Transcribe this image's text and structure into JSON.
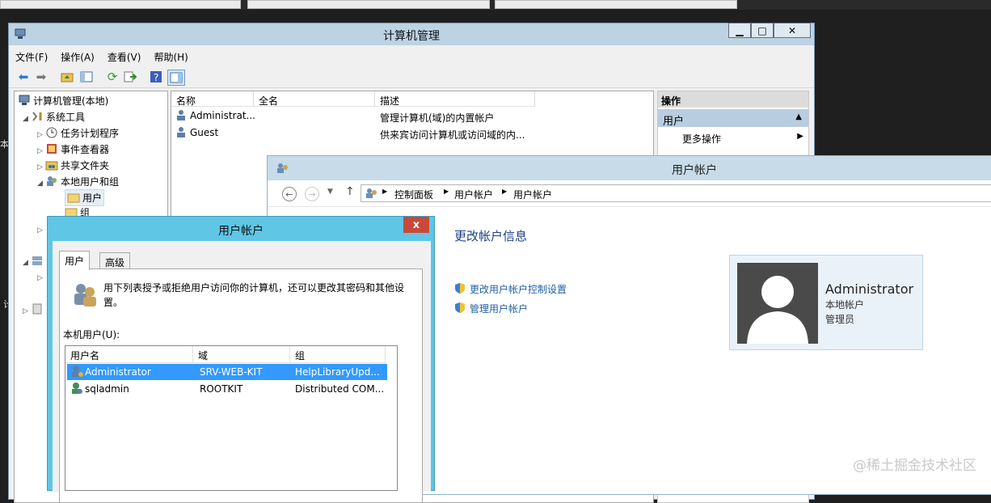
{
  "computer_management": {
    "title": "计算机管理",
    "menu": [
      "文件(F)",
      "操作(A)",
      "查看(V)",
      "帮助(H)"
    ],
    "tree": [
      {
        "label": "计算机管理(本地)",
        "icon": "computer-icon"
      },
      {
        "label": "系统工具",
        "icon": "tools-icon"
      },
      {
        "label": "任务计划程序",
        "icon": "clock-icon"
      },
      {
        "label": "事件查看器",
        "icon": "event-viewer-icon"
      },
      {
        "label": "共享文件夹",
        "icon": "shared-folder-icon"
      },
      {
        "label": "本地用户和组",
        "icon": "users-icon"
      },
      {
        "label": "用户",
        "icon": "folder-icon"
      },
      {
        "label": "组",
        "icon": "folder-icon"
      }
    ],
    "list": {
      "columns": [
        "名称",
        "全名",
        "描述"
      ],
      "rows": [
        {
          "name": "Administrat...",
          "full_name": "",
          "description": "管理计算机(域)的内置帐户"
        },
        {
          "name": "Guest",
          "full_name": "",
          "description": "供来宾访问计算机或访问域的内..."
        }
      ]
    },
    "actions": {
      "header": "操作",
      "section": "用户",
      "more": "更多操作"
    }
  },
  "user_accounts_panel": {
    "title": "用户帐户",
    "breadcrumb": [
      "控制面板",
      "用户帐户",
      "用户帐户"
    ],
    "heading": "更改帐户信息",
    "links": [
      "更改用户帐户控制设置",
      "管理用户帐户"
    ],
    "account": {
      "name": "Administrator",
      "type": "本地帐户",
      "role": "管理员"
    }
  },
  "user_accounts_dialog": {
    "title": "用户帐户",
    "close": "x",
    "tabs": [
      "用户",
      "高级"
    ],
    "intro": "用下列表授予或拒绝用户访问你的计算机，还可以更改其密码和其他设置。",
    "list_label": "本机用户(U):",
    "columns": [
      "用户名",
      "域",
      "组"
    ],
    "users": [
      {
        "user": "Administrator",
        "domain": "SRV-WEB-KIT",
        "group": "HelpLibraryUpd..."
      },
      {
        "user": "sqladmin",
        "domain": "ROOTKIT",
        "group": "Distributed COM..."
      }
    ]
  },
  "side_chars": [
    "本",
    "计"
  ],
  "watermark": "@稀土掘金技术社区",
  "colors": {
    "dialog_frame": "#5fc6e6",
    "selection": "#3399ff",
    "link": "#1e5fa8",
    "close_red": "#c7493a"
  }
}
